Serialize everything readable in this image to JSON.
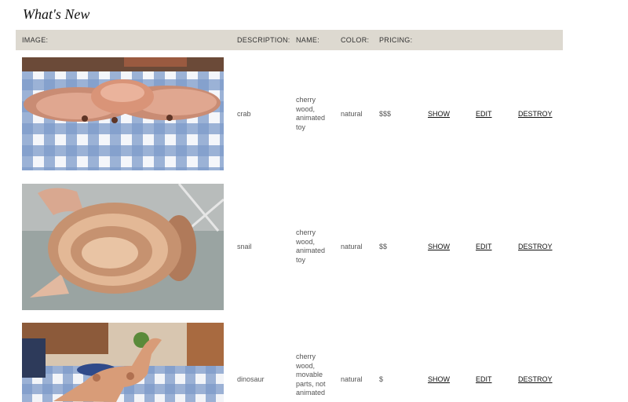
{
  "page": {
    "title": "What's New"
  },
  "table": {
    "headers": {
      "image": "IMAGE:",
      "description": "DESCRIPTION:",
      "name": "NAME:",
      "color": "COLOR:",
      "pricing": "PRICING:"
    },
    "rows": [
      {
        "description": "crab",
        "name": "cherry wood, animated toy",
        "color": "natural",
        "pricing": "$$$",
        "show": "SHOW",
        "edit": "EDIT",
        "destroy": "DESTROY",
        "image_subject": "wooden crab toy on blue gingham tablecloth"
      },
      {
        "description": "snail",
        "name": "cherry wood, animated toy",
        "color": "natural",
        "pricing": "$$",
        "show": "SHOW",
        "edit": "EDIT",
        "destroy": "DESTROY",
        "image_subject": "wooden snail toy held by hand"
      },
      {
        "description": "dinosaur",
        "name": "cherry wood, movable parts, not animated",
        "color": "natural",
        "pricing": "$",
        "show": "SHOW",
        "edit": "EDIT",
        "destroy": "DESTROY",
        "image_subject": "wooden dinosaur toy on gingham tablecloth"
      }
    ]
  }
}
